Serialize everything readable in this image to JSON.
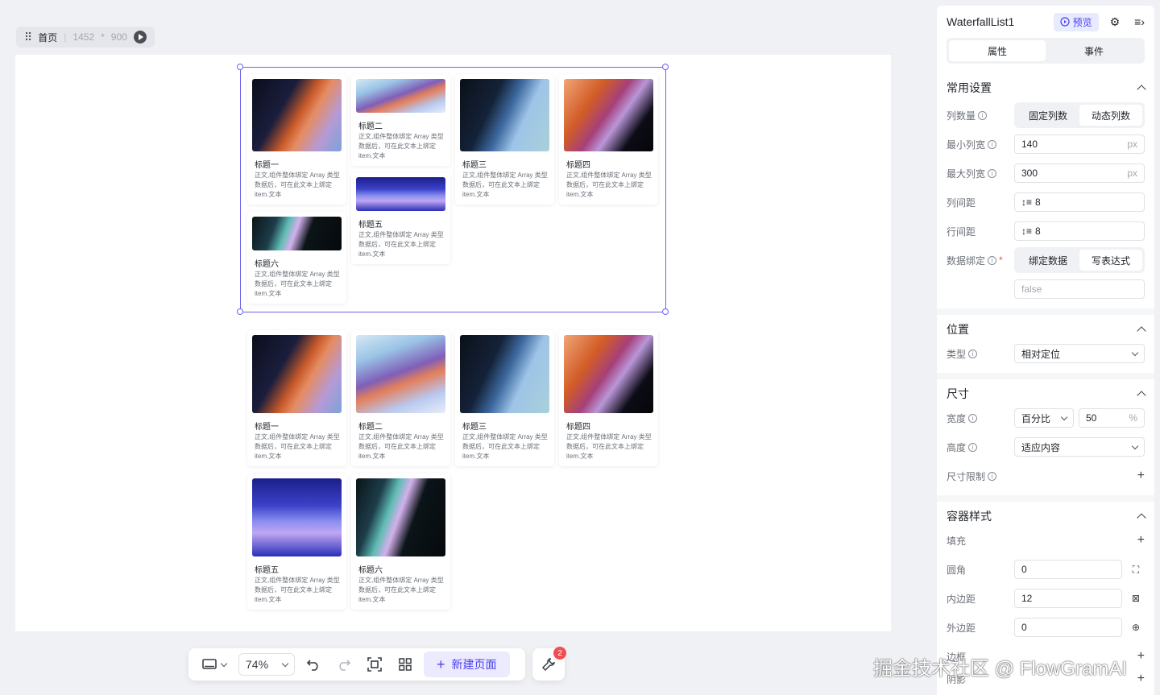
{
  "breadcrumb": {
    "page": "首页",
    "width": "1452",
    "times": "*",
    "height": "900"
  },
  "cards_top": [
    {
      "title": "标题一",
      "body": "正文,组件整体绑定 Array 类型数据后，可在此文本上绑定 item.文本"
    },
    {
      "title": "标题二",
      "body": "正文,组件整体绑定 Array 类型数据后，可在此文本上绑定 item.文本"
    },
    {
      "title": "标题三",
      "body": "正文,组件整体绑定 Array 类型数据后，可在此文本上绑定 item.文本"
    },
    {
      "title": "标题四",
      "body": "正文,组件整体绑定 Array 类型数据后，可在此文本上绑定 item.文本"
    },
    {
      "title": "标题五",
      "body": "正文,组件整体绑定 Array 类型数据后，可在此文本上绑定 item.文本"
    },
    {
      "title": "标题六",
      "body": "正文,组件整体绑定 Array 类型数据后，可在此文本上绑定 item.文本"
    }
  ],
  "cards_bottom": [
    {
      "title": "标题一",
      "body": "正文,组件整体绑定 Array 类型数据后，可在此文本上绑定 item.文本"
    },
    {
      "title": "标题二",
      "body": "正文,组件整体绑定 Array 类型数据后，可在此文本上绑定 item.文本"
    },
    {
      "title": "标题三",
      "body": "正文,组件整体绑定 Array 类型数据后，可在此文本上绑定 item.文本"
    },
    {
      "title": "标题四",
      "body": "正文,组件整体绑定 Array 类型数据后，可在此文本上绑定 item.文本"
    },
    {
      "title": "标题五",
      "body": "正文,组件整体绑定 Array 类型数据后，可在此文本上绑定 item.文本"
    },
    {
      "title": "标题六",
      "body": "正文,组件整体绑定 Array 类型数据后，可在此文本上绑定 item.文本"
    }
  ],
  "toolbar": {
    "zoom": "74%",
    "new_page": "新建页面",
    "badge": "2"
  },
  "watermark": "掘金技术社区 @ FlowGramAI",
  "panel": {
    "title": "WaterfallList1",
    "preview": "预览",
    "tab_props": "属性",
    "tab_events": "事件",
    "common": {
      "heading": "常用设置",
      "columns_label": "列数量",
      "columns_fixed": "固定列数",
      "columns_dynamic": "动态列数",
      "min_width_label": "最小列宽",
      "min_width": "140",
      "max_width_label": "最大列宽",
      "max_width": "300",
      "unit": "px",
      "col_gap_label": "列间距",
      "col_gap": "8",
      "row_gap_label": "行间距",
      "row_gap": "8",
      "binding_label": "数据绑定",
      "bind_data": "绑定数据",
      "write_expr": "写表达式",
      "binding_value": "false"
    },
    "position": {
      "heading": "位置",
      "type_label": "类型",
      "type_value": "相对定位"
    },
    "size": {
      "heading": "尺寸",
      "width_label": "宽度",
      "width_mode": "百分比",
      "width_value": "50",
      "width_unit": "%",
      "height_label": "高度",
      "height_mode": "适应内容",
      "limit_label": "尺寸限制"
    },
    "container": {
      "heading": "容器样式",
      "fill_label": "填充",
      "radius_label": "圆角",
      "radius": "0",
      "padding_label": "内边距",
      "padding": "12",
      "margin_label": "外边距",
      "margin": "0",
      "border_label": "边框",
      "shadow_label": "阴影"
    }
  }
}
